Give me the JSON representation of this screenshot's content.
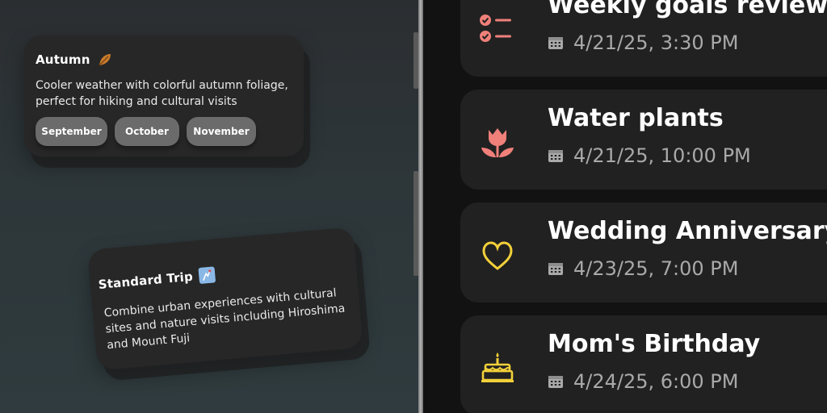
{
  "left": {
    "autumn": {
      "title": "Autumn",
      "icon": "fallen-leaf-icon",
      "description": "Cooler weather with colorful autumn foliage, perfect for hiking and cultural visits",
      "months": [
        "September",
        "October",
        "November"
      ]
    },
    "trip": {
      "title": "Standard Trip",
      "icon": "map-icon",
      "description": "Combine urban experiences with cultural sites and nature visits including Hiroshima and Mount Fuji"
    }
  },
  "events": [
    {
      "name": "Weekly goals review",
      "when": "4/21/25, 3:30 PM",
      "icon": "checklist-icon",
      "color": "#f0807a"
    },
    {
      "name": "Water plants",
      "when": "4/21/25, 10:00 PM",
      "icon": "tulip-icon",
      "color": "#f0807a"
    },
    {
      "name": "Wedding Anniversary",
      "when": "4/23/25, 7:00 PM",
      "icon": "heart-icon",
      "color": "#f3d03a"
    },
    {
      "name": "Mom's Birthday",
      "when": "4/24/25, 6:00 PM",
      "icon": "cake-icon",
      "color": "#f3d03a"
    }
  ]
}
